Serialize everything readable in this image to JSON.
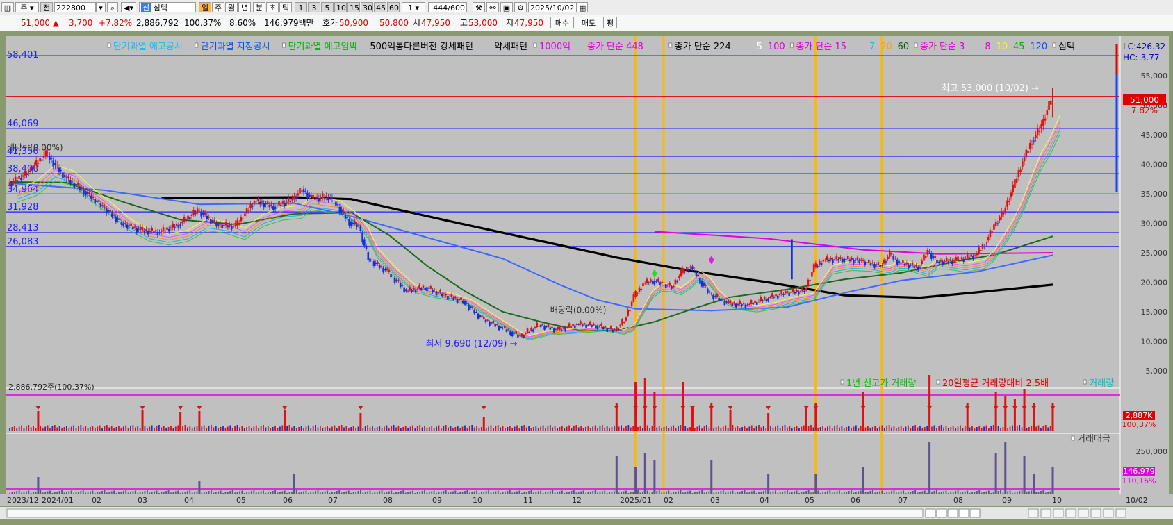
{
  "toolbar": {
    "period_sel": "주",
    "prev_label": "전",
    "code": "222800",
    "name": "심텍",
    "periods": [
      "일",
      "주",
      "월",
      "년",
      "분",
      "초",
      "틱"
    ],
    "nums": [
      "1",
      "3",
      "5",
      "10",
      "15",
      "30",
      "45",
      "60"
    ],
    "step": "1",
    "count": "444",
    "count_total": "/600",
    "date": "2025/10/02"
  },
  "quote": {
    "price": "51,000 ▲",
    "change": "3,700",
    "change_pct": "+7.82%",
    "volume": "2,886,792",
    "vol_ratio": "100.37%",
    "turnover": "8.60%",
    "amount": "146,979백만",
    "ask_label": "호가",
    "ask": "50,900",
    "bid": "50,800",
    "open_label": "시",
    "open": "47,950",
    "high_label": "고",
    "high": "53,000",
    "low_label": "저",
    "low": "47,950",
    "buy_btn": "매수",
    "sell_btn": "매도",
    "eval_btn": "평"
  },
  "legend": {
    "items": [
      {
        "text": "단기과열 예고공시",
        "color": "#00c0ff",
        "marker": true
      },
      {
        "text": "단기과열 지정공시",
        "color": "#0050ff",
        "marker": true
      },
      {
        "text": "단기과열 예고임박",
        "color": "#00b000",
        "marker": true
      },
      {
        "text": "500억봉다른버전 강세패턴",
        "color": "#000000",
        "marker": false
      },
      {
        "text": "약세패턴",
        "color": "#000000",
        "marker": false
      },
      {
        "text": "1000억",
        "color": "#e000e0",
        "marker": true
      },
      {
        "text": "종가 단순 448",
        "color": "#e000e0",
        "marker": false
      },
      {
        "text": "종가 단순 224",
        "color": "#000000",
        "marker": true
      },
      {
        "text": "5",
        "color": "#ffffff",
        "marker": false
      },
      {
        "text": "100",
        "color": "#e000e0",
        "marker": false
      },
      {
        "text": "종가 단순 15",
        "color": "#e000e0",
        "marker": true
      },
      {
        "text": "7",
        "color": "#00c0ff",
        "marker": false
      },
      {
        "text": "20",
        "color": "#ffa000",
        "marker": false
      },
      {
        "text": "60",
        "color": "#006000",
        "marker": false
      },
      {
        "text": "종가 단순 3",
        "color": "#e000e0",
        "marker": true
      },
      {
        "text": "8",
        "color": "#e000e0",
        "marker": false
      },
      {
        "text": "10",
        "color": "#ffff00",
        "marker": false
      },
      {
        "text": "45",
        "color": "#00b000",
        "marker": false
      },
      {
        "text": "120",
        "color": "#0050ff",
        "marker": false
      },
      {
        "text": "심텍",
        "color": "#000000",
        "marker": true
      }
    ],
    "lc": "LC:426.32",
    "hc": "HC:-3.77"
  },
  "chart_data": {
    "type": "candlestick",
    "title": "심텍",
    "x_labels": [
      "2023/12",
      "2024/01",
      "02",
      "03",
      "04",
      "05",
      "06",
      "07",
      "08",
      "09",
      "10",
      "11",
      "12",
      "2025/01",
      "02",
      "03",
      "04",
      "05",
      "06",
      "07",
      "08",
      "09",
      "10"
    ],
    "x_start": "2023-12-01",
    "x_end_label": "10/02",
    "price_axis": {
      "min": 0,
      "max": 60000,
      "ticks": [
        "55,000",
        "50,000",
        "45,000",
        "40,000",
        "35,000",
        "30,000",
        "25,000",
        "20,000",
        "15,000",
        "10,000",
        "5,000"
      ]
    },
    "levels": [
      {
        "label": "58,401",
        "price": 58401,
        "color": "#2020ff"
      },
      {
        "label": "46,069",
        "price": 46069,
        "color": "#2020ff"
      },
      {
        "label": "41,356",
        "price": 41356,
        "color": "#2020ff"
      },
      {
        "label": "38,400",
        "price": 38400,
        "color": "#2020ff"
      },
      {
        "label": "34,964",
        "price": 34964,
        "color": "#2020ff"
      },
      {
        "label": "31,928",
        "price": 31928,
        "color": "#2020ff"
      },
      {
        "label": "28,413",
        "price": 28413,
        "color": "#2020ff"
      },
      {
        "label": "26,083",
        "price": 26083,
        "color": "#2020ff"
      },
      {
        "label": "",
        "price": 51500,
        "color": "#e00000"
      }
    ],
    "high_annotation": "최고 53,000 (10/02) →",
    "low_annotation": "최저 9,690 (12/09) →",
    "dividend_labels": [
      "배당락(0.00%)",
      "배당락(0.00%)"
    ],
    "current_price": {
      "label": "51,000",
      "pct": "7.82%",
      "value": 51000
    },
    "price_series": [
      [
        0,
        36500
      ],
      [
        2,
        38500
      ],
      [
        4,
        41800
      ],
      [
        6,
        37800
      ],
      [
        8,
        35500
      ],
      [
        10,
        32800
      ],
      [
        12,
        30000
      ],
      [
        14,
        28800
      ],
      [
        16,
        28500
      ],
      [
        18,
        29800
      ],
      [
        20,
        32200
      ],
      [
        22,
        29800
      ],
      [
        24,
        29500
      ],
      [
        26,
        33800
      ],
      [
        28,
        32800
      ],
      [
        30,
        34000
      ],
      [
        31,
        35800
      ],
      [
        32,
        34200
      ],
      [
        34,
        34500
      ],
      [
        36,
        30200
      ],
      [
        37,
        29500
      ],
      [
        38,
        24000
      ],
      [
        40,
        21800
      ],
      [
        42,
        18500
      ],
      [
        44,
        19200
      ],
      [
        46,
        17800
      ],
      [
        48,
        16800
      ],
      [
        50,
        13800
      ],
      [
        52,
        12300
      ],
      [
        53,
        11600
      ],
      [
        54,
        10800
      ],
      [
        56,
        12800
      ],
      [
        58,
        11900
      ],
      [
        60,
        12900
      ],
      [
        62,
        12700
      ],
      [
        64,
        11800
      ],
      [
        65,
        13500
      ],
      [
        66,
        17500
      ],
      [
        67,
        19800
      ],
      [
        68,
        20300
      ],
      [
        69,
        19800
      ],
      [
        70,
        19200
      ],
      [
        71,
        21600
      ],
      [
        72,
        22700
      ],
      [
        73,
        20300
      ],
      [
        74,
        18000
      ],
      [
        75,
        17200
      ],
      [
        76,
        16400
      ],
      [
        78,
        16200
      ],
      [
        80,
        17300
      ],
      [
        82,
        18200
      ],
      [
        84,
        18600
      ],
      [
        85,
        22500
      ],
      [
        86,
        23800
      ],
      [
        88,
        24000
      ],
      [
        90,
        23600
      ],
      [
        92,
        22800
      ],
      [
        93,
        24700
      ],
      [
        94,
        23300
      ],
      [
        96,
        22600
      ],
      [
        97,
        25200
      ],
      [
        98,
        23500
      ],
      [
        100,
        23700
      ],
      [
        102,
        24600
      ],
      [
        103,
        26500
      ],
      [
        104,
        29500
      ],
      [
        105,
        32000
      ],
      [
        106,
        36000
      ],
      [
        107,
        40500
      ],
      [
        108,
        44000
      ],
      [
        109,
        46500
      ],
      [
        110,
        51000
      ]
    ],
    "ma_series": [
      {
        "name": "224",
        "color": "#000000",
        "points": [
          [
            16,
            34300
          ],
          [
            30,
            34400
          ],
          [
            36,
            34100
          ],
          [
            46,
            30500
          ],
          [
            56,
            27000
          ],
          [
            64,
            24200
          ],
          [
            72,
            21900
          ],
          [
            80,
            20000
          ],
          [
            88,
            17800
          ],
          [
            96,
            17400
          ],
          [
            102,
            18300
          ],
          [
            110,
            19600
          ]
        ]
      },
      {
        "name": "120",
        "color": "#3a6aff",
        "points": [
          [
            0,
            36800
          ],
          [
            10,
            35600
          ],
          [
            20,
            33200
          ],
          [
            30,
            33400
          ],
          [
            36,
            31200
          ],
          [
            44,
            27600
          ],
          [
            52,
            24000
          ],
          [
            58,
            19600
          ],
          [
            62,
            17000
          ],
          [
            66,
            15500
          ],
          [
            74,
            15200
          ],
          [
            82,
            15800
          ],
          [
            88,
            18200
          ],
          [
            94,
            20300
          ],
          [
            102,
            21800
          ],
          [
            110,
            24600
          ]
        ]
      },
      {
        "name": "60",
        "color": "#1a6a1a",
        "points": [
          [
            0,
            37000
          ],
          [
            6,
            36900
          ],
          [
            12,
            33600
          ],
          [
            18,
            30600
          ],
          [
            24,
            29800
          ],
          [
            30,
            31600
          ],
          [
            36,
            31800
          ],
          [
            40,
            28000
          ],
          [
            44,
            22800
          ],
          [
            48,
            18500
          ],
          [
            52,
            15000
          ],
          [
            56,
            13300
          ],
          [
            60,
            11900
          ],
          [
            64,
            11800
          ],
          [
            68,
            13300
          ],
          [
            72,
            15500
          ],
          [
            76,
            17500
          ],
          [
            82,
            18800
          ],
          [
            88,
            20500
          ],
          [
            94,
            21600
          ],
          [
            100,
            23600
          ],
          [
            104,
            24700
          ],
          [
            110,
            27800
          ]
        ]
      },
      {
        "name": "448",
        "color": "#e000e0",
        "points": [
          [
            68,
            28600
          ],
          [
            80,
            27400
          ],
          [
            90,
            25500
          ],
          [
            98,
            24800
          ],
          [
            110,
            25000
          ]
        ]
      }
    ],
    "volume_axis": {
      "label": "2,886,792주(100,37%)",
      "current": "2,887K",
      "pct": "100,37%"
    },
    "volume_legend": [
      {
        "text": "1년 신고가 거래량",
        "color": "#00c000"
      },
      {
        "text": "20일평균 거래량대비 2.5배",
        "color": "#e00000"
      },
      {
        "text": "거래량",
        "color": "#00c0c0"
      }
    ],
    "volume_spikes": [
      [
        3,
        28
      ],
      [
        14,
        30
      ],
      [
        18,
        26
      ],
      [
        20,
        28
      ],
      [
        29,
        30
      ],
      [
        37,
        25
      ],
      [
        50,
        20
      ],
      [
        64,
        40
      ],
      [
        66,
        70
      ],
      [
        67,
        75
      ],
      [
        68,
        55
      ],
      [
        71,
        70
      ],
      [
        72,
        35
      ],
      [
        74,
        40
      ],
      [
        76,
        30
      ],
      [
        80,
        25
      ],
      [
        84,
        35
      ],
      [
        85,
        40
      ],
      [
        90,
        55
      ],
      [
        97,
        80
      ],
      [
        101,
        40
      ],
      [
        104,
        55
      ],
      [
        105,
        50
      ],
      [
        106,
        45
      ],
      [
        107,
        60
      ],
      [
        108,
        40
      ],
      [
        110,
        40
      ]
    ],
    "amount_legend": "거래대금",
    "amount_axis": {
      "tick": "250,000",
      "current": "146,979",
      "pct": "110,16%"
    },
    "amount_spikes": [
      [
        3,
        25
      ],
      [
        20,
        20
      ],
      [
        30,
        30
      ],
      [
        64,
        55
      ],
      [
        66,
        40
      ],
      [
        67,
        60
      ],
      [
        68,
        50
      ],
      [
        74,
        50
      ],
      [
        80,
        30
      ],
      [
        85,
        30
      ],
      [
        90,
        40
      ],
      [
        97,
        75
      ],
      [
        104,
        60
      ],
      [
        105,
        75
      ],
      [
        107,
        55
      ],
      [
        108,
        30
      ],
      [
        110,
        40
      ]
    ],
    "yellow_markers": [
      66,
      69,
      85,
      92
    ]
  }
}
